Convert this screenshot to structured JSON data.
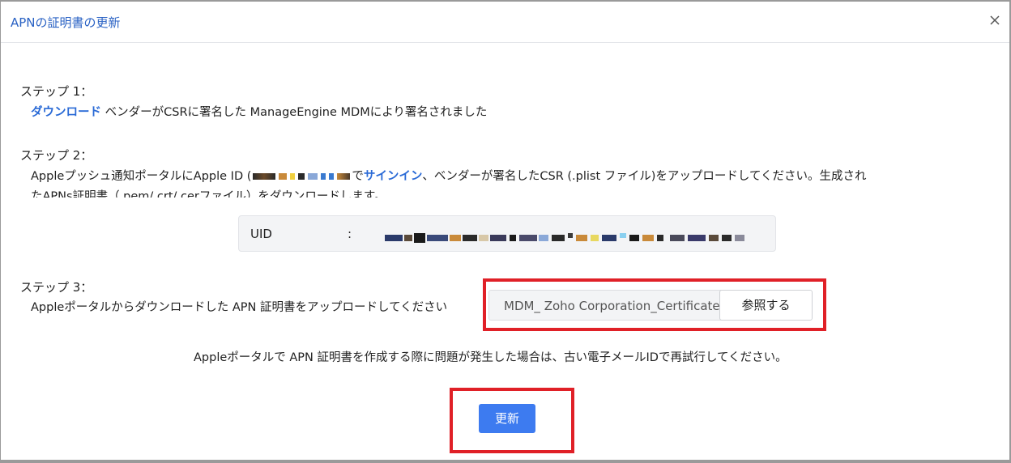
{
  "dialog": {
    "title": "APNの証明書の更新",
    "close_icon": "close-icon"
  },
  "step1": {
    "title": "ステップ 1：",
    "link": "ダウンロード",
    "text": "ベンダーがCSRに署名した ManageEngine MDMにより署名されました"
  },
  "step2": {
    "title": "ステップ 2：",
    "line1_prefix": "Appleプッシュ通知ポータルにApple ID (",
    "line1_suffix": "で",
    "signin_link": "サインイン",
    "line1_rest": "、ベンダーが署名したCSR (.plist ファイル)をアップロードしてください。生成され",
    "line2": "たAPNs証明書（.pem/.crt/.cerファイル）をダウンロードします。"
  },
  "uid": {
    "label": "UID",
    "separator": ":"
  },
  "step3": {
    "title": "ステップ 3：",
    "text": "Appleポータルからダウンロードした APN 証明書をアップロードしてください",
    "file_value": "MDM_ Zoho Corporation_Certificate.pem",
    "browse_label": "参照する"
  },
  "note": "Appleポータルで APN 証明書を作成する際に問題が発生した場合は、古い電子メールIDで再試行してください。",
  "update_label": "更新",
  "colors": {
    "accent": "#3d7bf0",
    "title": "#2a62c4",
    "highlight": "#e02027"
  }
}
